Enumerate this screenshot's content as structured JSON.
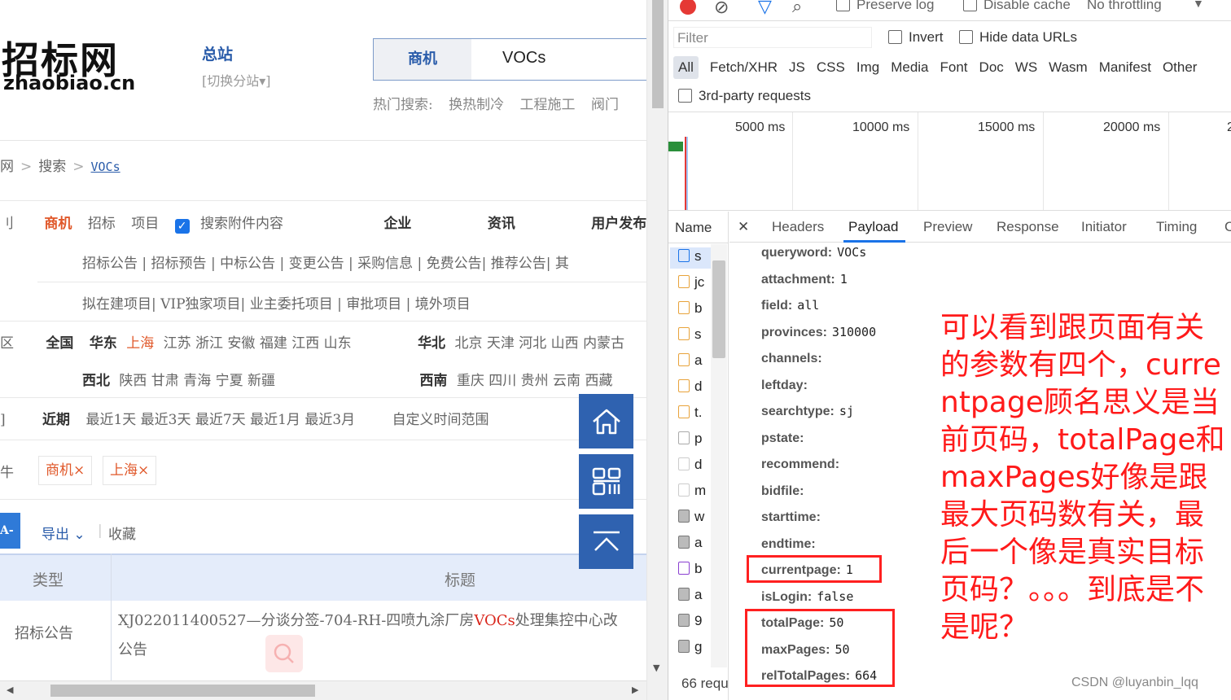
{
  "site": {
    "logo_cn": "招标网",
    "logo_en": "zhaobiao.cn",
    "station": "总站",
    "switch": "[切换分站▾]",
    "search": {
      "category": "商机",
      "value": "VOCs"
    },
    "hot_label": "热门搜索:",
    "hot": [
      "换热制冷",
      "工程施工",
      "阀门"
    ],
    "breadcrumb": [
      "网",
      "搜索",
      "VOCs"
    ],
    "category_row": {
      "lead": "刂",
      "items": [
        "商机",
        "招标",
        "项目"
      ],
      "checkbox_label": "搜索附件内容",
      "right": [
        "企业",
        "资讯",
        "用户发布"
      ]
    },
    "subtypes1": "招标公告 | 招标预告 | 中标公告 | 变更公告 | 采购信息 | 免费公告| 推荐公告| 其",
    "subtypes2": "拟在建项目| VIP独家项目| 业主委托项目 | 审批项目 | 境外项目",
    "region_lead": "区",
    "region1": {
      "all": "全国",
      "east": "华东",
      "selected": "上海",
      "rest": "江苏 浙江 安徽 福建 江西 山东",
      "north": "华北",
      "north_rest": "北京 天津 河北 山西 内蒙古"
    },
    "region2": {
      "northwest": "西北",
      "nw_rest": "陕西 甘肃 青海 宁夏 新疆",
      "southwest": "西南",
      "sw_rest": "重庆 四川 贵州 云南 西藏"
    },
    "time_lead": "]",
    "time_row": {
      "label": "近期",
      "items": "最近1天 最近3天 最近7天 最近1月 最近3月",
      "custom": "自定义时间范围"
    },
    "cond_lead": "牛",
    "tags": [
      "商机×",
      "上海×"
    ],
    "toolbar": {
      "blue": "A-",
      "export": "导出 ⌄",
      "collect": "收藏"
    },
    "table": {
      "headers": [
        "类型",
        "标题"
      ],
      "row_type": "招标公告",
      "row_title_pre": "XJ022011400527—分谈分签-704-RH-四喷九涂厂房",
      "row_title_hl": "VOCs",
      "row_title_post": "处理集控中心改",
      "row_title_line2": "公告"
    }
  },
  "devtools": {
    "toolbar": {
      "preserve_log": "Preserve log",
      "disable_cache": "Disable cache",
      "throttle": "No throttling"
    },
    "filter_placeholder": "Filter",
    "invert": "Invert",
    "hide_urls": "Hide data URLs",
    "types": [
      "All",
      "Fetch/XHR",
      "JS",
      "CSS",
      "Img",
      "Media",
      "Font",
      "Doc",
      "WS",
      "Wasm",
      "Manifest",
      "Other"
    ],
    "third_party": "3rd-party requests",
    "ticks": [
      "5000 ms",
      "10000 ms",
      "15000 ms",
      "20000 ms",
      "2"
    ],
    "name_header": "Name",
    "tabs": [
      "Headers",
      "Payload",
      "Preview",
      "Response",
      "Initiator",
      "Timing",
      "C"
    ],
    "requests": [
      "s",
      "jc",
      "b",
      "s",
      "a",
      "d",
      "t.",
      "p",
      "d",
      "m",
      "w",
      "a",
      "b",
      "a",
      "9",
      "g"
    ],
    "payload": [
      {
        "k": "queryword:",
        "v": "VOCs"
      },
      {
        "k": "attachment:",
        "v": "1"
      },
      {
        "k": "field:",
        "v": "all"
      },
      {
        "k": "provinces:",
        "v": "310000"
      },
      {
        "k": "channels:",
        "v": ""
      },
      {
        "k": "leftday:",
        "v": ""
      },
      {
        "k": "searchtype:",
        "v": "sj"
      },
      {
        "k": "pstate:",
        "v": ""
      },
      {
        "k": "recommend:",
        "v": ""
      },
      {
        "k": "bidfile:",
        "v": ""
      },
      {
        "k": "starttime:",
        "v": ""
      },
      {
        "k": "endtime:",
        "v": ""
      },
      {
        "k": "currentpage:",
        "v": "1"
      },
      {
        "k": "isLogin:",
        "v": "false"
      },
      {
        "k": "totalPage:",
        "v": "50"
      },
      {
        "k": "maxPages:",
        "v": "50"
      },
      {
        "k": "relTotalPages:",
        "v": "664"
      }
    ],
    "status": "66 requ",
    "annotation": "可以看到跟页面有关的参数有四个，currentpage顾名思义是当前页码，totalPage和maxPages好像是跟最大页码数有关，最后一个像是真实目标页码？。。。到底是不是呢？",
    "watermark": "CSDN @luyanbin_lqq"
  },
  "colors": {
    "accent": "#2f62b0",
    "highlight": "#e0582a",
    "annotation": "#ff1a1a",
    "devtools_blue": "#1a73e8"
  }
}
